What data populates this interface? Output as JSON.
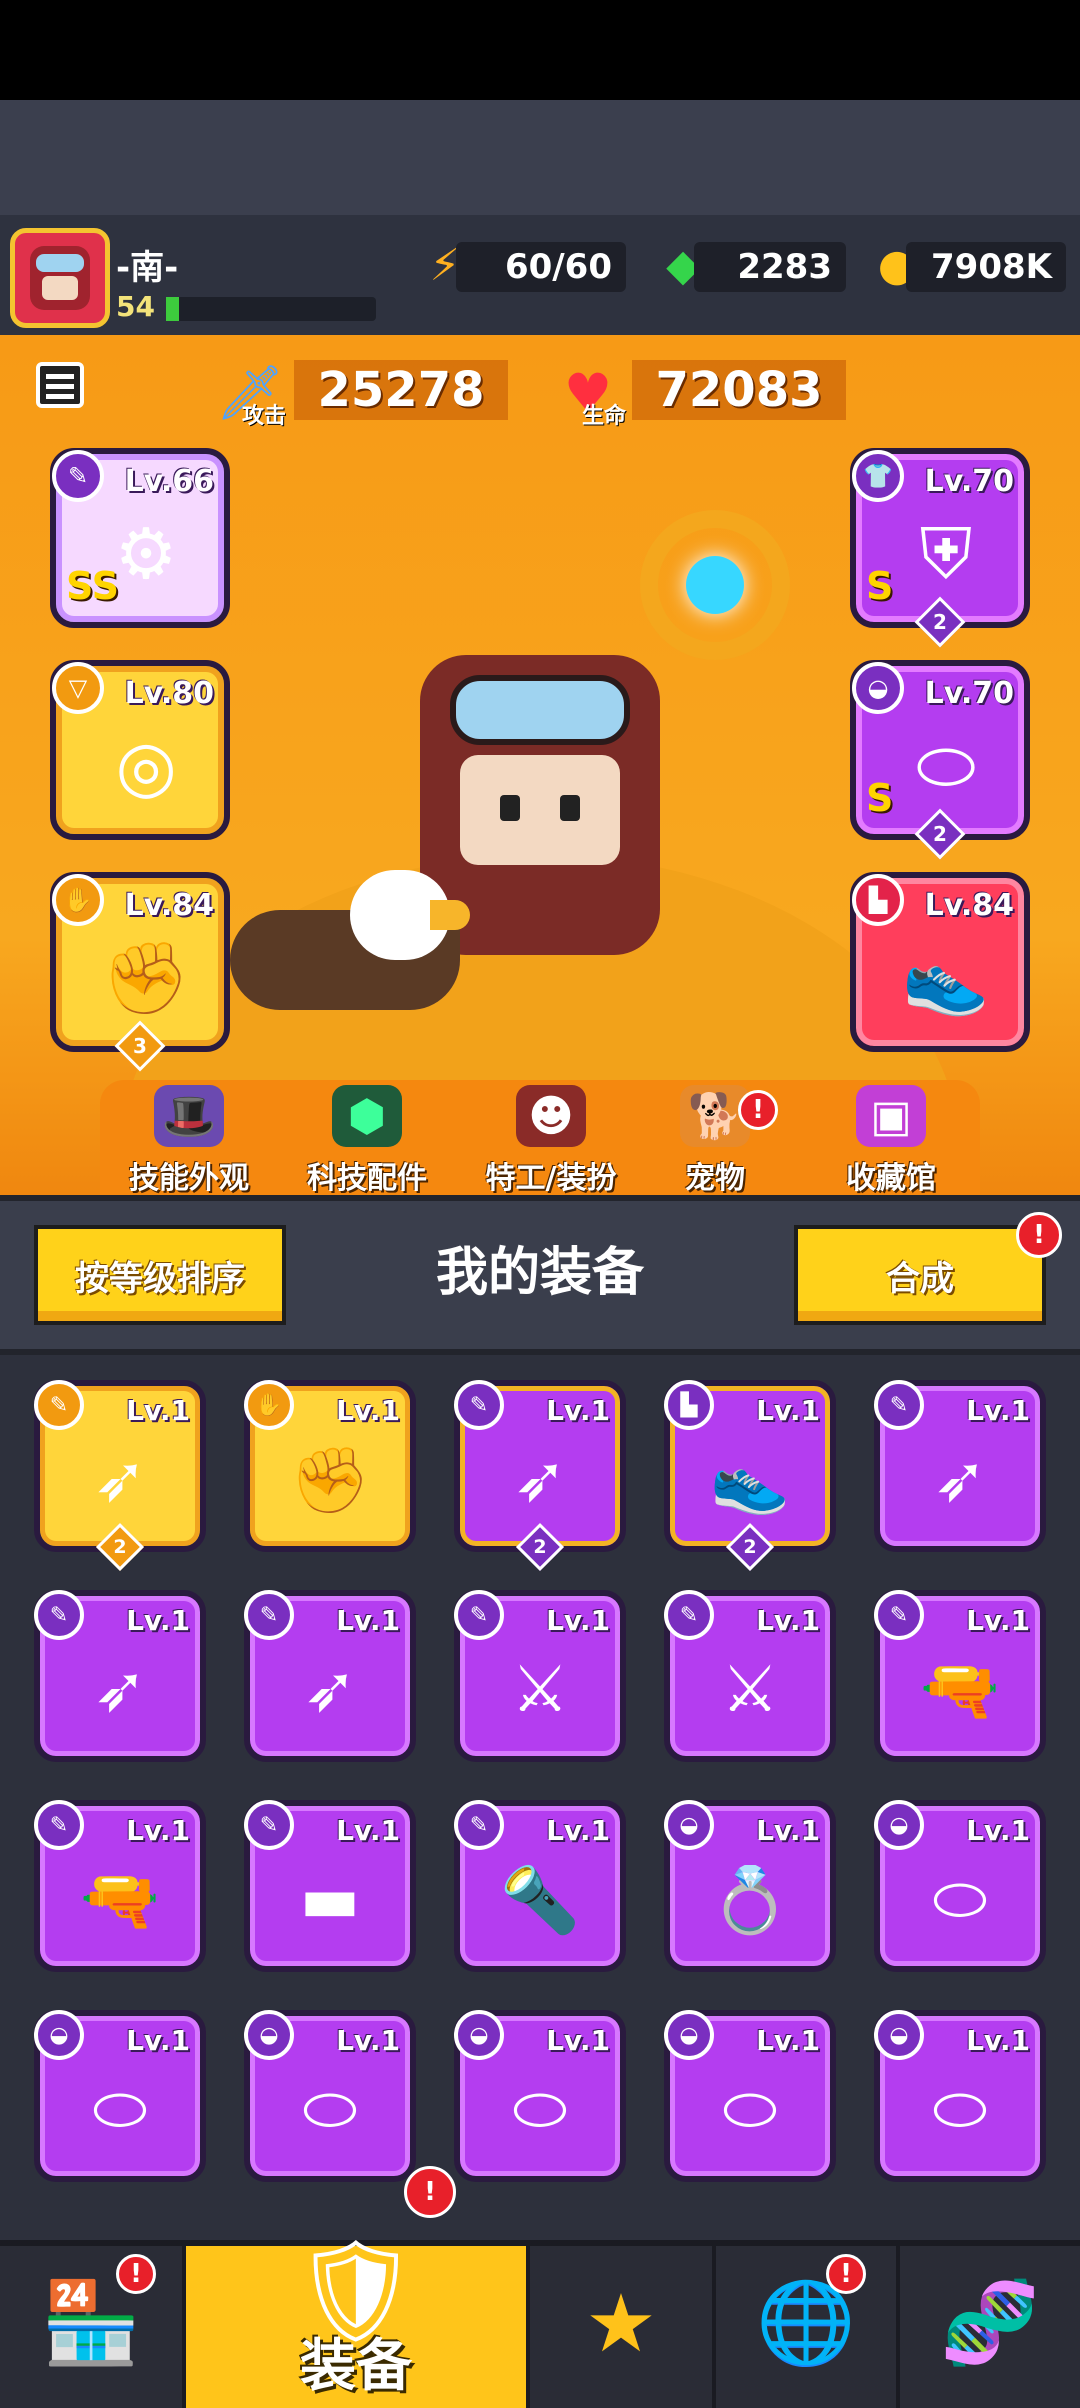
{
  "player": {
    "name": "-南-",
    "level": "54",
    "xp_fraction": 0.06
  },
  "resources": {
    "energy": "60/60",
    "gems": "2283",
    "coins": "7908K"
  },
  "stats": {
    "attack_label": "攻击",
    "attack_value": "25278",
    "hp_label": "生命",
    "hp_value": "72083"
  },
  "equipped": [
    {
      "slot": "weapon",
      "level": "Lv.66",
      "grade": "SS",
      "icon": "staff-icon",
      "rarity": "light"
    },
    {
      "slot": "necklace",
      "level": "Lv.80",
      "icon": "spiked-collar-icon",
      "rarity": "gold"
    },
    {
      "slot": "gloves",
      "level": "Lv.84",
      "count": "3",
      "icon": "gauntlet-icon",
      "rarity": "gold"
    },
    {
      "slot": "armor",
      "level": "Lv.70",
      "grade": "S",
      "count": "2",
      "icon": "armor-icon",
      "rarity": "purple"
    },
    {
      "slot": "belt",
      "level": "Lv.70",
      "grade": "S",
      "count": "2",
      "icon": "belt-icon",
      "rarity": "purple"
    },
    {
      "slot": "boots",
      "level": "Lv.84",
      "icon": "boots-icon",
      "rarity": "red"
    }
  ],
  "tabs": [
    {
      "label": "技能外观",
      "icon": "hat-icon"
    },
    {
      "label": "科技配件",
      "icon": "tech-icon"
    },
    {
      "label": "特工/装扮",
      "icon": "agent-icon"
    },
    {
      "label": "宠物",
      "icon": "pet-icon",
      "alert": "!"
    },
    {
      "label": "收藏馆",
      "icon": "museum-icon"
    }
  ],
  "panel": {
    "sort_label": "按等级排序",
    "title": "我的装备",
    "merge_label": "合成",
    "merge_alert": "!"
  },
  "inventory": [
    {
      "level": "Lv.1",
      "icon": "kunai-icon",
      "rarity": "gold",
      "count": "2"
    },
    {
      "level": "Lv.1",
      "icon": "gauntlet-icon",
      "rarity": "gold"
    },
    {
      "level": "Lv.1",
      "icon": "kunai-icon",
      "rarity": "pg",
      "count": "2"
    },
    {
      "level": "Lv.1",
      "icon": "boots-icon",
      "rarity": "pg",
      "count": "2"
    },
    {
      "level": "Lv.1",
      "icon": "kunai-icon",
      "rarity": "purple"
    },
    {
      "level": "Lv.1",
      "icon": "kunai-icon",
      "rarity": "purple"
    },
    {
      "level": "Lv.1",
      "icon": "kunai-icon",
      "rarity": "purple"
    },
    {
      "level": "Lv.1",
      "icon": "sabre-icon",
      "rarity": "purple"
    },
    {
      "level": "Lv.1",
      "icon": "sabre-icon",
      "rarity": "purple"
    },
    {
      "level": "Lv.1",
      "icon": "revolver-icon",
      "rarity": "purple"
    },
    {
      "level": "Lv.1",
      "icon": "revolver-icon",
      "rarity": "purple"
    },
    {
      "level": "Lv.1",
      "icon": "shotgun-icon",
      "rarity": "purple"
    },
    {
      "level": "Lv.1",
      "icon": "torch-icon",
      "rarity": "purple"
    },
    {
      "level": "Lv.1",
      "icon": "ring-icon",
      "rarity": "purple"
    },
    {
      "level": "Lv.1",
      "icon": "belt-icon",
      "rarity": "purple"
    },
    {
      "level": "Lv.1",
      "icon": "belt-icon",
      "rarity": "purple"
    },
    {
      "level": "Lv.1",
      "icon": "belt-icon",
      "rarity": "purple"
    },
    {
      "level": "Lv.1",
      "icon": "belt-icon",
      "rarity": "purple"
    },
    {
      "level": "Lv.1",
      "icon": "belt-icon",
      "rarity": "purple"
    },
    {
      "level": "Lv.1",
      "icon": "belt-icon",
      "rarity": "purple"
    }
  ],
  "bottom_nav": [
    {
      "icon": "shop-icon",
      "alert": "!"
    },
    {
      "icon": "equipment-icon",
      "label": "装备",
      "alert": "!",
      "active": true
    },
    {
      "icon": "star-battle-icon"
    },
    {
      "icon": "planet-icon",
      "alert": "!"
    },
    {
      "icon": "dna-capsule-icon"
    }
  ]
}
